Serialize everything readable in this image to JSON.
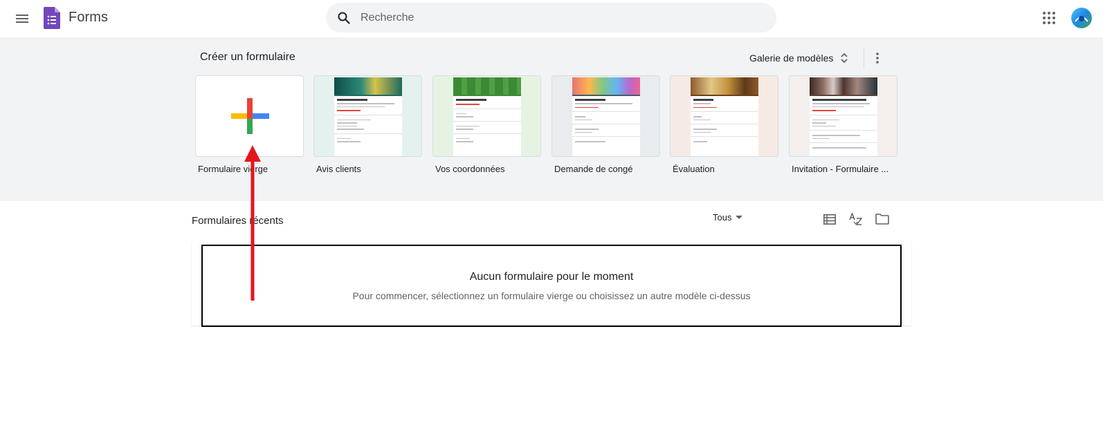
{
  "header": {
    "app_name": "Forms",
    "search_placeholder": "Recherche",
    "menu_icon": "hamburger-menu-icon",
    "apps_icon": "google-apps-grid-icon",
    "colors": {
      "forms_purple": "#7248b9",
      "search_bg": "#f1f3f4"
    }
  },
  "templates": {
    "heading": "Créer un formulaire",
    "gallery_label": "Galerie de modèles",
    "items": [
      {
        "label": "Formulaire vierge",
        "kind": "blank"
      },
      {
        "label": "Avis clients",
        "header_color": "#1e6a5e",
        "bar_color": "#1e6a5e"
      },
      {
        "label": "Vos coordonnées",
        "header_color": "#3d8a34",
        "bar_color": "#3d8a34"
      },
      {
        "label": "Demande de congé",
        "header_color": "#c97f6a",
        "bar_color": "#455a64"
      },
      {
        "label": "Évaluation",
        "header_color": "#8d5a2b",
        "bar_color": "#6d3f1c"
      },
      {
        "label": "Invitation - Formulaire ...",
        "header_color": "#5a4a3c",
        "bar_color": "#5d4037"
      }
    ]
  },
  "recent": {
    "title": "Formulaires récents",
    "owner_filter": "Tous",
    "empty_title": "Aucun formulaire pour le moment",
    "empty_subtitle": "Pour commencer, sélectionnez un formulaire vierge ou choisissez un autre modèle ci-dessus"
  },
  "annotation": {
    "arrow_color": "#e3161e",
    "box_color": "#000000"
  }
}
